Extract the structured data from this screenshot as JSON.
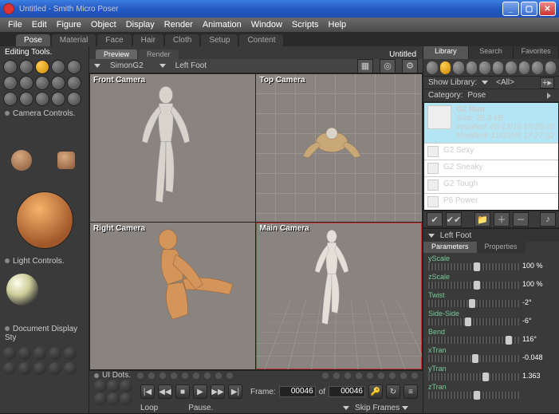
{
  "titlebar": {
    "title": "Untitled - Smith Micro Poser"
  },
  "menus": [
    "File",
    "Edit",
    "Figure",
    "Object",
    "Display",
    "Render",
    "Animation",
    "Window",
    "Scripts",
    "Help"
  ],
  "roomtabs": [
    "Pose",
    "Material",
    "Face",
    "Hair",
    "Cloth",
    "Setup",
    "Content"
  ],
  "active_room": "Pose",
  "leftcol": {
    "editing_tools": "Editing Tools.",
    "camera_controls": "Camera Controls.",
    "light_controls": "Light Controls.",
    "doc_display": "Document Display Sty",
    "ui_dots": "UI Dots."
  },
  "doc": {
    "tabs": [
      "Preview",
      "Render"
    ],
    "active_tab": "Preview",
    "name": "Untitled",
    "figure": "SimonG2",
    "actor": "Left Foot",
    "viewports": [
      {
        "label": "Front Camera",
        "active": false
      },
      {
        "label": "Top Camera",
        "active": false
      },
      {
        "label": "Right Camera",
        "active": false
      },
      {
        "label": "Main Camera",
        "active": true
      }
    ]
  },
  "timeline": {
    "pause": "Pause.",
    "loop": "Loop",
    "frame_label": "Frame:",
    "frame": "00046",
    "of": "of",
    "total": "00046",
    "skip": "Skip Frames"
  },
  "library": {
    "tabs": [
      "Library",
      "Search",
      "Favorites"
    ],
    "active_tab": "Library",
    "show_label": "Show Library:",
    "show_value": "<All>",
    "cat_label": "Category:",
    "cat_value": "Pose",
    "items": [
      {
        "name": "G2 Run",
        "size": "Size: 25.3 kB",
        "installed": "Installed: 05/13/10 15:26:20",
        "modified": "Modified: 11/03/06 17:27:32",
        "sel": true
      },
      {
        "name": "G2 Sexy"
      },
      {
        "name": "G2 Sneaky"
      },
      {
        "name": "G2 Tough"
      },
      {
        "name": "P6 Power"
      }
    ]
  },
  "params": {
    "part": "Left Foot",
    "tabs": [
      "Parameters",
      "Properties"
    ],
    "active_tab": "Parameters",
    "dials": [
      {
        "name": "yScale",
        "value": "100 %",
        "pos": 50
      },
      {
        "name": "zScale",
        "value": "100 %",
        "pos": 50
      },
      {
        "name": "Twist",
        "value": "-2°",
        "pos": 45
      },
      {
        "name": "Side-Side",
        "value": "-6°",
        "pos": 40
      },
      {
        "name": "Bend",
        "value": "116°",
        "pos": 85
      },
      {
        "name": "xTran",
        "value": "-0.048",
        "pos": 48
      },
      {
        "name": "yTran",
        "value": "1.363",
        "pos": 60
      },
      {
        "name": "zTran",
        "value": "",
        "pos": 50
      }
    ]
  }
}
